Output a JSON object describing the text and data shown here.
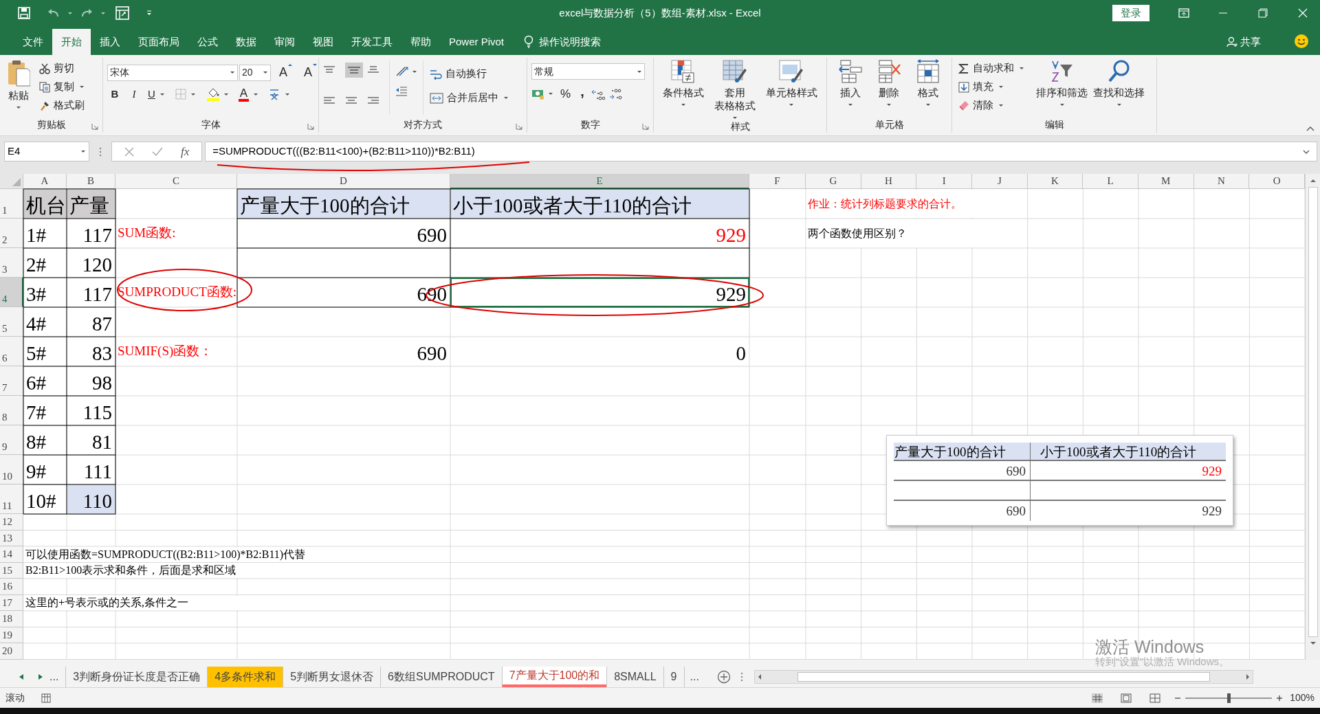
{
  "window": {
    "title": "excel与数据分析（5）数组-素材.xlsx - Excel",
    "sign_in": "登录"
  },
  "ribbon_tabs": [
    {
      "label": "文件",
      "selected": false
    },
    {
      "label": "开始",
      "selected": true
    },
    {
      "label": "插入",
      "selected": false
    },
    {
      "label": "页面布局",
      "selected": false
    },
    {
      "label": "公式",
      "selected": false
    },
    {
      "label": "数据",
      "selected": false
    },
    {
      "label": "审阅",
      "selected": false
    },
    {
      "label": "视图",
      "selected": false
    },
    {
      "label": "开发工具",
      "selected": false
    },
    {
      "label": "帮助",
      "selected": false
    },
    {
      "label": "Power Pivot",
      "selected": false
    }
  ],
  "tell_me": "操作说明搜索",
  "share": "共享",
  "clipboard": {
    "label": "剪贴板",
    "paste": "粘贴",
    "cut": "剪切",
    "copy": "复制",
    "format_painter": "格式刷"
  },
  "font": {
    "label": "字体",
    "font_name": "宋体",
    "font_size": "20",
    "grow": "A",
    "shrink": "A",
    "bold": "B",
    "italic": "I",
    "underline": "U",
    "font_color": "A"
  },
  "alignment": {
    "label": "对齐方式",
    "wrap_text": "自动换行",
    "merge_center": "合并后居中"
  },
  "number": {
    "label": "数字",
    "format": "常规",
    "percent": "%",
    "comma": ","
  },
  "styles": {
    "label": "样式",
    "items": [
      {
        "lines": [
          "条件格式"
        ]
      },
      {
        "lines": [
          "套用",
          "表格格式"
        ]
      },
      {
        "lines": [
          "单元格样式"
        ]
      }
    ]
  },
  "cells": {
    "label": "单元格",
    "items": [
      "插入",
      "删除",
      "格式"
    ]
  },
  "editing": {
    "label": "编辑",
    "autosum": "自动求和",
    "fill": "填充",
    "clear": "清除",
    "sort_filter": "排序和筛选",
    "find_select": "查找和选择"
  },
  "formula_bar": {
    "name_box": "E4",
    "insert_function": "fx",
    "formula": "=SUMPRODUCT(((B2:B11<100)+(B2:B11>110))*B2:B11)"
  },
  "sheet": {
    "columns": [
      "A",
      "B",
      "C",
      "D",
      "E",
      "F",
      "G",
      "H",
      "I",
      "J",
      "K",
      "L",
      "M",
      "N",
      "O"
    ],
    "rows": [
      {
        "number": "1",
        "cells": {
          "a": {
            "text": "机台",
            "kind": "title",
            "color": "#d0cece",
            "red": false,
            "selected": false
          },
          "b": {
            "text": "产量",
            "kind": "title",
            "color": "#d0cece",
            "red": false,
            "selected": false
          },
          "d": {
            "text": "产量大于100的合计",
            "kind": "title",
            "color": "#d9e1f2",
            "red": false,
            "selected": false
          },
          "e": {
            "text": "小于100或者大于110的合计",
            "kind": "title",
            "color": "#d9e1f2",
            "red": false,
            "selected": false
          },
          "g": {
            "text": "作业：统计列标题要求的合计。",
            "kind": "note",
            "red": true,
            "selected": false
          }
        }
      },
      {
        "number": "2",
        "cells": {
          "a": {
            "text": "1#",
            "kind": "title",
            "red": false,
            "selected": false
          },
          "b": {
            "text": "117",
            "kind": "value",
            "red": false,
            "selected": false
          },
          "c": {
            "text": "SUM函数:",
            "kind": "label",
            "red": true,
            "selected": false
          },
          "d": {
            "text": "690",
            "kind": "value",
            "red": false,
            "selected": false
          },
          "e": {
            "text": "929",
            "kind": "value",
            "red": true,
            "selected": false
          },
          "g": {
            "text": "两个函数使用区别？",
            "kind": "note",
            "red": false,
            "selected": false
          }
        }
      },
      {
        "number": "3",
        "cells": {
          "a": {
            "text": "2#",
            "kind": "title",
            "red": false,
            "selected": false
          },
          "b": {
            "text": "120",
            "kind": "value",
            "red": false,
            "selected": false
          }
        }
      },
      {
        "number": "4",
        "cells": {
          "a": {
            "text": "3#",
            "kind": "title",
            "red": false,
            "selected": false
          },
          "b": {
            "text": "117",
            "kind": "value",
            "red": false,
            "selected": false
          },
          "c": {
            "text": "SUMPRODUCT函数:",
            "kind": "label",
            "red": true,
            "selected": false
          },
          "d": {
            "text": "690",
            "kind": "value",
            "red": false,
            "selected": false
          },
          "e": {
            "text": "929",
            "kind": "value",
            "red": false,
            "selected": true
          }
        }
      },
      {
        "number": "5",
        "cells": {
          "a": {
            "text": "4#",
            "kind": "title",
            "red": false,
            "selected": false
          },
          "b": {
            "text": "87",
            "kind": "value",
            "red": false,
            "selected": false
          }
        }
      },
      {
        "number": "6",
        "cells": {
          "a": {
            "text": "5#",
            "kind": "title",
            "red": false,
            "selected": false
          },
          "b": {
            "text": "83",
            "kind": "value",
            "red": false,
            "selected": false
          },
          "c": {
            "text": "SUMIF(S)函数：",
            "kind": "label",
            "red": true,
            "selected": false
          },
          "d": {
            "text": "690",
            "kind": "value",
            "red": false,
            "selected": false
          },
          "e": {
            "text": "0",
            "kind": "value",
            "red": false,
            "selected": false
          }
        }
      },
      {
        "number": "7",
        "cells": {
          "a": {
            "text": "6#",
            "kind": "title",
            "red": false,
            "selected": false
          },
          "b": {
            "text": "98",
            "kind": "value",
            "red": false,
            "selected": false
          }
        }
      },
      {
        "number": "8",
        "cells": {
          "a": {
            "text": "7#",
            "kind": "title",
            "red": false,
            "selected": false
          },
          "b": {
            "text": "115",
            "kind": "value",
            "red": false,
            "selected": false
          }
        }
      },
      {
        "number": "9",
        "cells": {
          "a": {
            "text": "8#",
            "kind": "title",
            "red": false,
            "selected": false
          },
          "b": {
            "text": "81",
            "kind": "value",
            "red": false,
            "selected": false
          }
        }
      },
      {
        "number": "10",
        "cells": {
          "a": {
            "text": "9#",
            "kind": "title",
            "red": false,
            "selected": false
          },
          "b": {
            "text": "111",
            "kind": "value",
            "red": false,
            "selected": false
          }
        }
      },
      {
        "number": "11",
        "cells": {
          "a": {
            "text": "10#",
            "kind": "title",
            "red": false,
            "selected": false
          },
          "b": {
            "text": "110",
            "kind": "value",
            "color": "#d9e1f2",
            "red": false,
            "selected": false
          }
        }
      },
      {
        "number": "12"
      },
      {
        "number": "13"
      },
      {
        "number": "14",
        "cells": {
          "a": {
            "text": "可以使用函数=SUMPRODUCT((B2:B11>100)*B2:B11)代替",
            "kind": "note",
            "red": false,
            "selected": false
          }
        }
      },
      {
        "number": "15",
        "cells": {
          "a": {
            "text": "B2:B11>100表示求和条件，后面是求和区域",
            "kind": "note",
            "red": false,
            "selected": false
          }
        }
      },
      {
        "number": "16"
      },
      {
        "number": "17",
        "cells": {
          "a": {
            "text": "这里的+号表示或的关系,条件之一",
            "kind": "note",
            "red": false,
            "selected": false
          }
        }
      },
      {
        "number": "18"
      },
      {
        "number": "19"
      },
      {
        "number": "20"
      }
    ]
  },
  "floating_table": {
    "columns": [
      "产量大于100的合计",
      "小于100或者大于110的合计"
    ],
    "rows": [
      {
        "kind": "values",
        "cells": [
          {
            "text": "690",
            "red": false
          },
          {
            "text": "929",
            "red": true
          }
        ]
      },
      {
        "kind": "blank"
      },
      {
        "kind": "values",
        "cells": [
          {
            "text": "690",
            "red": false
          },
          {
            "text": "929",
            "red": false
          }
        ]
      }
    ]
  },
  "annotations": [
    {
      "kind": "underline"
    },
    {
      "kind": "ellipse"
    },
    {
      "kind": "ellipse"
    }
  ],
  "activation": {
    "title": "激活 Windows",
    "text": "转到“设置”以激活 Windows。"
  },
  "sheet_tabs": {
    "overflow_left": "...",
    "overflow_right": "...",
    "items": [
      {
        "label": "3判断身份证长度是否正确",
        "selected": false
      },
      {
        "label": "4多条件求和",
        "selected": false,
        "color": "#ffc000"
      },
      {
        "label": "5判断男女退休否",
        "selected": false
      },
      {
        "label": "6数组SUMPRODUCT",
        "selected": false
      },
      {
        "label": "7产量大于100的和",
        "selected": true,
        "color": "#ff6b6b"
      },
      {
        "label": "8SMALL",
        "selected": false
      },
      {
        "label": "9",
        "selected": false
      }
    ]
  },
  "status_bar": {
    "mode": "滚动",
    "zoom_slider": {
      "level": 0.5
    },
    "zoom_label": "100%"
  }
}
